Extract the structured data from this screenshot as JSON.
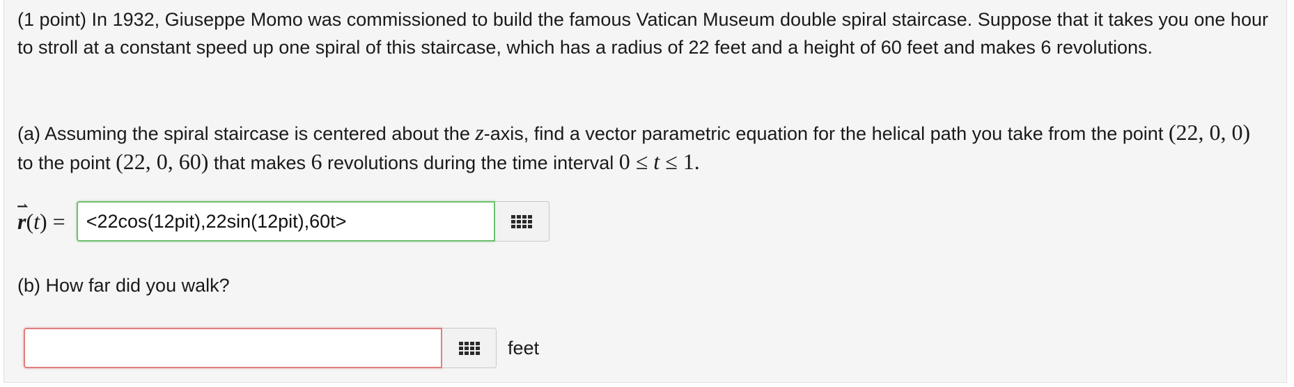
{
  "problem": {
    "intro": "(1 point) In 1932, Giuseppe Momo was commissioned to build the famous Vatican Museum double spiral staircase. Suppose that it takes you one hour to stroll at a constant speed up one spiral of this staircase, which has a radius of 22 feet and a height of 60 feet and makes 6 revolutions.",
    "part_a": {
      "text_1": "(a) Assuming the spiral staircase is centered about the ",
      "z_var": "z",
      "text_2": "-axis, find a vector parametric equation for the helical path you take from the point ",
      "point_start": "(22, 0, 0)",
      "text_3": " to the point ",
      "point_end": "(22, 0, 60)",
      "text_4": " that makes ",
      "revs": "6",
      "text_5": " revolutions during the time interval ",
      "interval_lo": "0 ≤ ",
      "interval_t": "t",
      "interval_hi": " ≤ 1.",
      "label_r": "r",
      "label_arrow": "⇀",
      "label_rest": "(",
      "label_t": "t",
      "label_eq": ") =",
      "answer_value": "<22cos(12pit),22sin(12pit),60t>"
    },
    "part_b": {
      "text": "(b) How far did you walk?",
      "answer_value": "",
      "unit": "feet"
    }
  },
  "icons": {
    "equation_editor": "equation-editor-grid-icon"
  },
  "colors": {
    "correct_border": "#6fbf6f",
    "incorrect_border": "#e07f7f",
    "panel_bg": "#f5f5f5"
  }
}
